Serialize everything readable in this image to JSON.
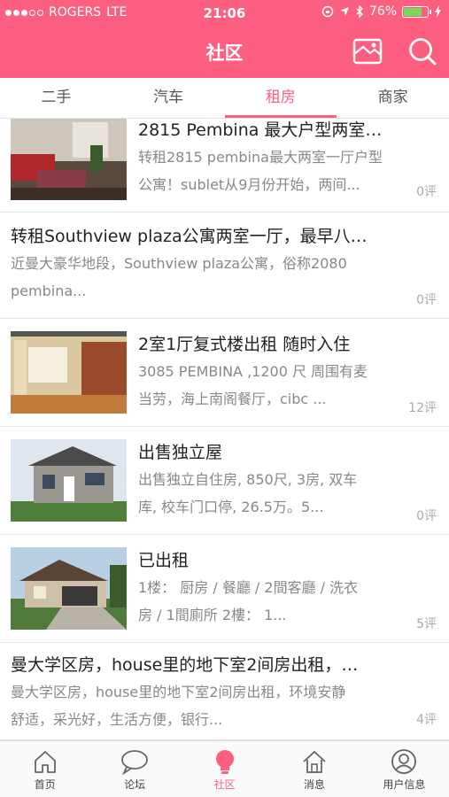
{
  "status_bar": {
    "carrier": "ROGERS",
    "network": "LTE",
    "time": "21:06",
    "battery": "76%",
    "battery_level": 0.76
  },
  "nav": {
    "title": "社区",
    "right_icons": [
      "wallet-icon",
      "search-icon"
    ]
  },
  "tabs": [
    {
      "label": "二手",
      "active": false
    },
    {
      "label": "汽车",
      "active": false
    },
    {
      "label": "租房",
      "active": true
    },
    {
      "label": "商家",
      "active": false
    }
  ],
  "posts": [
    {
      "title": "2815 Pembina 最大户型两室…",
      "desc_line1": "转租2815 pembina最大两室一厅户型",
      "desc_line2": "公寓！sublet从9月份开始，两间...",
      "comments": "0评"
    },
    {
      "title": "转租Southview plaza公寓两室一厅，最早八…",
      "desc_line1": "近曼大豪华地段，Southview plaza公寓，俗称2080",
      "desc_line2": "pembina...",
      "comments": "0评"
    },
    {
      "title": "2室1厅复式楼出租 随时入住",
      "desc_line1": "3085 PEMBINA ,1200 尺 周围有麦",
      "desc_line2": "当劳，海上南阁餐厅，cibc ...",
      "comments": "12评"
    },
    {
      "title": "出售独立屋",
      "desc_line1": "出售独立自住房, 850尺, 3房, 双车",
      "desc_line2": "库, 校车门口停, 26.5万。5...",
      "comments": "0评"
    },
    {
      "title": "已出租",
      "desc_line1": "1楼： 厨房 / 餐廳 / 2間客廳 / 洗衣",
      "desc_line2": "房 / 1間廁所 2樓： 1...",
      "comments": "5评"
    },
    {
      "title": "曼大学区房，house里的地下室2间房出租，…",
      "desc_line1": "曼大学区房，house里的地下室2间房出租，环境安静",
      "desc_line2": "舒适，采光好，生活方便，银行...",
      "comments": "4评"
    }
  ],
  "tabbar": [
    {
      "label": "首页",
      "icon": "home-icon",
      "active": false
    },
    {
      "label": "论坛",
      "icon": "chat-bubble-icon",
      "active": false
    },
    {
      "label": "社区",
      "icon": "lightbulb-icon",
      "active": true
    },
    {
      "label": "消息",
      "icon": "house-icon",
      "active": false
    },
    {
      "label": "用户信息",
      "icon": "user-icon",
      "active": false
    }
  ],
  "colors": {
    "brand": "#fd5f80",
    "battery": "#7ed957"
  }
}
